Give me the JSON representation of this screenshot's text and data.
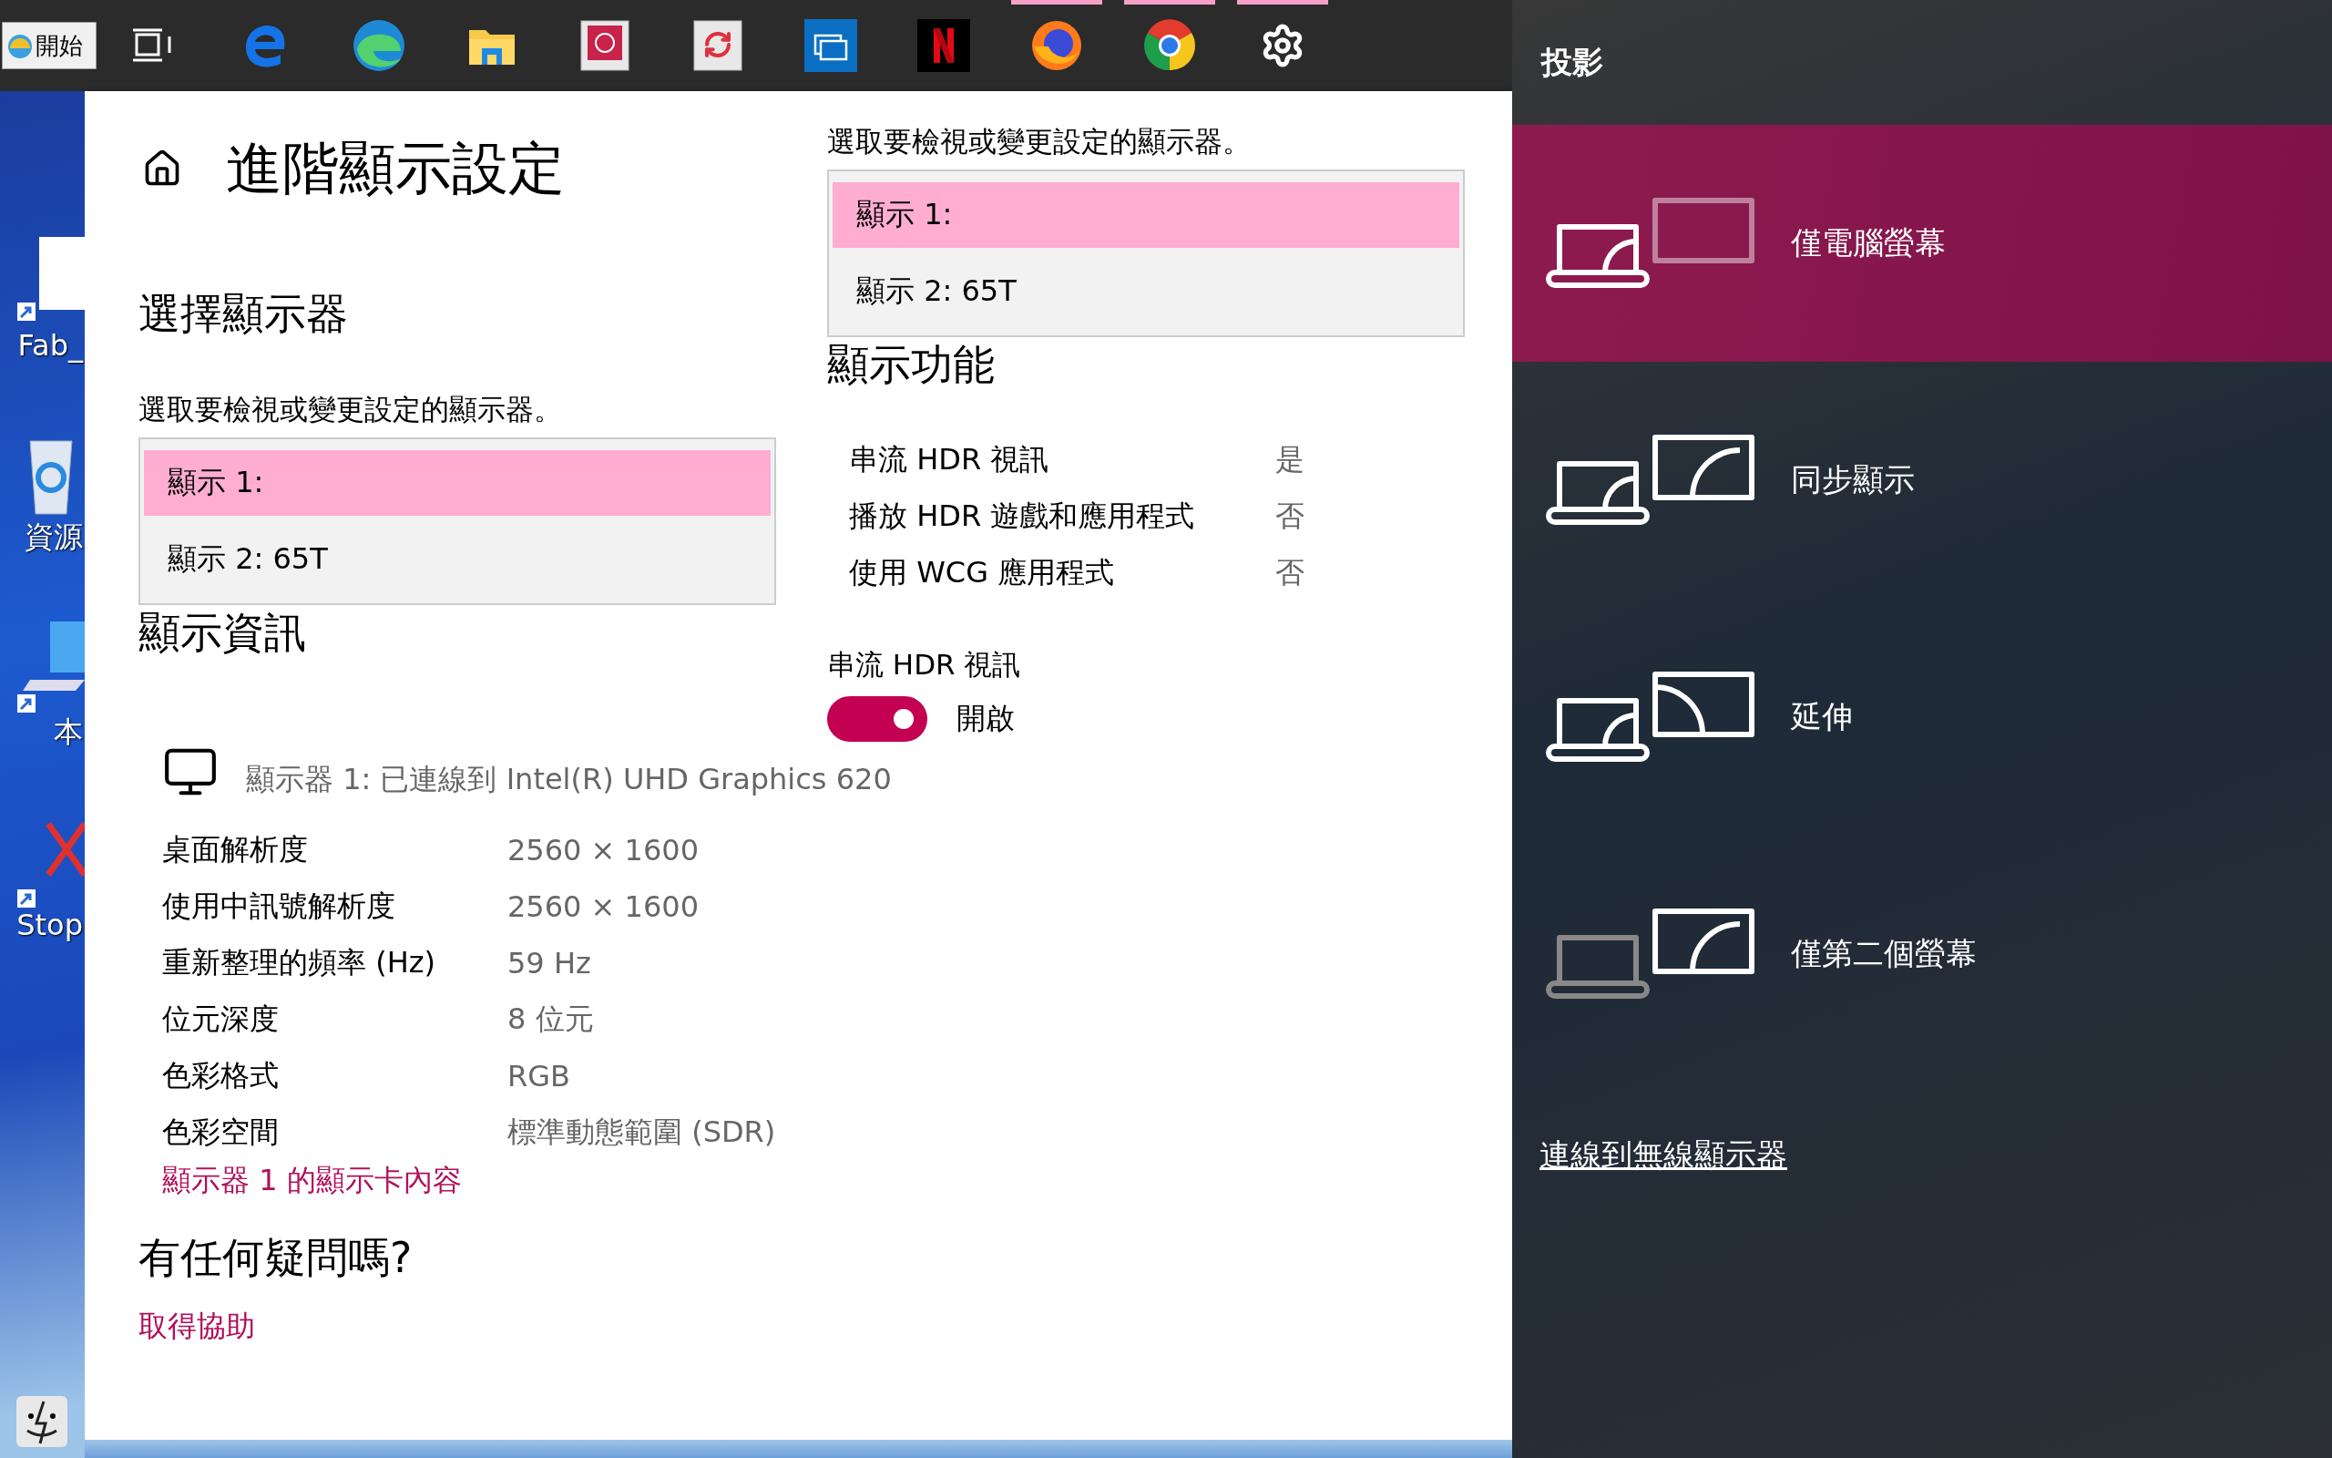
{
  "taskbar": {
    "start_label": "開始",
    "apps": [
      {
        "kind": "task_view",
        "running": false
      },
      {
        "kind": "e_logo",
        "running": false
      },
      {
        "kind": "swirl_logo",
        "running": false
      },
      {
        "kind": "folder",
        "running": false
      },
      {
        "kind": "help_book",
        "running": false
      },
      {
        "kind": "sync",
        "running": false
      },
      {
        "kind": "window",
        "running": false
      },
      {
        "kind": "stripes",
        "running": false
      },
      {
        "kind": "fox_globe",
        "running": true
      },
      {
        "kind": "tricolor",
        "running": true
      },
      {
        "kind": "gear",
        "running": true
      }
    ]
  },
  "desktop": {
    "icons": [
      {
        "kind": "document",
        "label": "Fab_"
      },
      {
        "kind": "recycle",
        "label": "資源"
      },
      {
        "kind": "computer",
        "label": "本"
      },
      {
        "kind": "cross",
        "label": "Stop"
      }
    ]
  },
  "settings": {
    "title": "進階顯示設定",
    "left": {
      "select_heading": "選擇顯示器",
      "select_prompt": "選取要檢視或變更設定的顯示器。",
      "display_list": [
        {
          "label": "顯示 1:",
          "selected": true
        },
        {
          "label": "顯示 2: 65T",
          "selected": false
        }
      ],
      "info_heading": "顯示資訊",
      "adapter": "顯示器 1: 已連線到 Intel(R) UHD Graphics 620",
      "info_rows": [
        {
          "label": "桌面解析度",
          "value": "2560 × 1600"
        },
        {
          "label": "使用中訊號解析度",
          "value": "2560 × 1600"
        },
        {
          "label": "重新整理的頻率 (Hz)",
          "value": "59 Hz"
        },
        {
          "label": "位元深度",
          "value": "8 位元"
        },
        {
          "label": "色彩格式",
          "value": "RGB"
        },
        {
          "label": "色彩空間",
          "value": "標準動態範圍 (SDR)"
        }
      ],
      "adapter_link": "顯示器 1 的顯示卡內容",
      "help_heading": "有任何疑問嗎?",
      "help_link": "取得協助"
    },
    "right": {
      "select_prompt": "選取要檢視或變更設定的顯示器。",
      "display_list": [
        {
          "label": "顯示 1:",
          "selected": true
        },
        {
          "label": "顯示 2: 65T",
          "selected": false
        }
      ],
      "features_heading": "顯示功能",
      "features": [
        {
          "label": "串流 HDR 視訊",
          "value": "是"
        },
        {
          "label": "播放 HDR 遊戲和應用程式",
          "value": "否"
        },
        {
          "label": "使用 WCG 應用程式",
          "value": "否"
        }
      ],
      "hdr_label": "串流 HDR 視訊",
      "hdr_toggle": {
        "on": true,
        "label": "開啟"
      }
    }
  },
  "project": {
    "title": "投影",
    "options": [
      {
        "kind": "pc_only",
        "label": "僅電腦螢幕",
        "selected": true
      },
      {
        "kind": "duplicate",
        "label": "同步顯示",
        "selected": false
      },
      {
        "kind": "extend",
        "label": "延伸",
        "selected": false
      },
      {
        "kind": "second_only",
        "label": "僅第二個螢幕",
        "selected": false
      }
    ],
    "wireless_link": "連線到無線顯示器"
  }
}
